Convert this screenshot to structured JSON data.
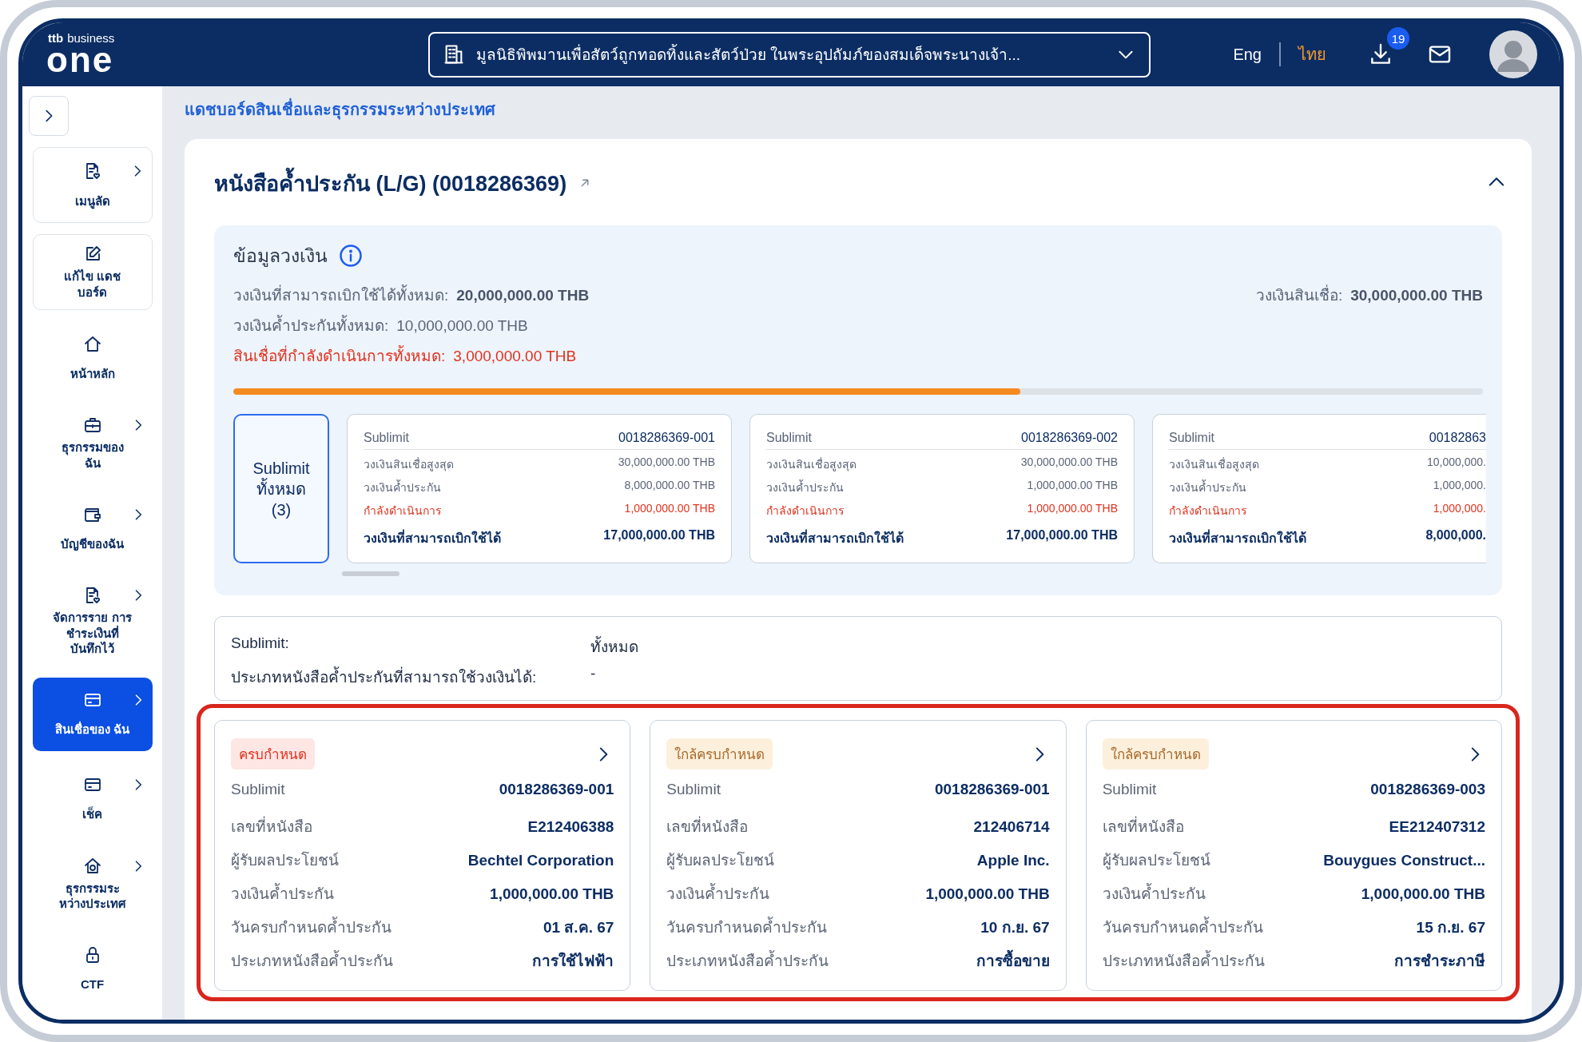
{
  "header": {
    "logo": {
      "brand": "ttb",
      "tagline": "business",
      "name": "one"
    },
    "organization": {
      "value": "มูลนิธิพิพมานเพื่อสัตว์ถูกทอดทิ้งและสัตว์ป่วย ในพระอุปถัมภ์ของสมเด็จพระนางเจ้า..."
    },
    "languages": [
      {
        "label": "Eng",
        "selected": false
      },
      {
        "label": "ไทย",
        "selected": true
      }
    ],
    "downloads_badge": "19"
  },
  "sidebar": {
    "items": [
      {
        "label": "เมนูลัด",
        "kind": "shortcut",
        "expandable": true,
        "selected": false
      },
      {
        "label": "แก้ไข แดชบอร์ด",
        "kind": "shortcut",
        "expandable": false,
        "selected": false
      },
      {
        "label": "หน้าหลัก",
        "kind": "nav",
        "expandable": false,
        "selected": false
      },
      {
        "label": "ธุรกรรมของ ฉัน",
        "kind": "nav",
        "expandable": true,
        "selected": false
      },
      {
        "label": "บัญชีของฉัน",
        "kind": "nav",
        "expandable": true,
        "selected": false
      },
      {
        "label": "จัดการราย การชำระเงินที่ บันทึกไว้",
        "kind": "nav",
        "expandable": true,
        "selected": false
      },
      {
        "label": "สินเชื่อของ ฉัน",
        "kind": "nav",
        "expandable": true,
        "selected": true
      },
      {
        "label": "เช็ค",
        "kind": "nav",
        "expandable": true,
        "selected": false
      },
      {
        "label": "ธุรกรรมระ หว่างประเทศ",
        "kind": "nav",
        "expandable": true,
        "selected": false
      },
      {
        "label": "CTF",
        "kind": "nav",
        "expandable": false,
        "selected": false
      }
    ]
  },
  "breadcrumb": "แดชบอร์ดสินเชื่อและธุรกรรมระหว่างประเทศ",
  "lg": {
    "title": "หนังสือค้ำประกัน (L/G) (0018286369)",
    "expanded": true,
    "limit_info": {
      "heading": "ข้อมูลวงเงิน",
      "lines": [
        {
          "label": "วงเงินที่สามารถเบิกใช้ได้ทั้งหมด:",
          "value": "20,000,000.00 THB",
          "kind": "available"
        },
        {
          "label": "วงเงินค้ำประกันทั้งหมด:",
          "value": "10,000,000.00 THB",
          "kind": "guarantee"
        },
        {
          "label": "สินเชื่อที่กำลังดำเนินการทั้งหมด:",
          "value": "3,000,000.00 THB",
          "kind": "pending"
        }
      ],
      "credit_limit": {
        "label": "วงเงินสินเชื่อ:",
        "value": "30,000,000.00 THB"
      },
      "level": 0.63,
      "sublimit_all": {
        "label": "Sublimit ทั้งหมด (3)",
        "selected": true
      },
      "sublimits": [
        {
          "id_label": "Sublimit",
          "id": "0018286369-001",
          "selected": false,
          "rows": [
            {
              "label": "วงเงินสินเชื่อสูงสุด",
              "value": "30,000,000.00 THB",
              "kind": "normal"
            },
            {
              "label": "วงเงินค้ำประกัน",
              "value": "8,000,000.00 THB",
              "kind": "normal"
            },
            {
              "label": "กำลังดำเนินการ",
              "value": "1,000,000.00 THB",
              "kind": "pending"
            },
            {
              "label": "วงเงินที่สามารถเบิกใช้ได้",
              "value": "17,000,000.00 THB",
              "kind": "total"
            }
          ]
        },
        {
          "id_label": "Sublimit",
          "id": "0018286369-002",
          "selected": false,
          "rows": [
            {
              "label": "วงเงินสินเชื่อสูงสุด",
              "value": "30,000,000.00 THB",
              "kind": "normal"
            },
            {
              "label": "วงเงินค้ำประกัน",
              "value": "1,000,000.00 THB",
              "kind": "normal"
            },
            {
              "label": "กำลังดำเนินการ",
              "value": "1,000,000.00 THB",
              "kind": "pending"
            },
            {
              "label": "วงเงินที่สามารถเบิกใช้ได้",
              "value": "17,000,000.00 THB",
              "kind": "total"
            }
          ]
        },
        {
          "id_label": "Sublimit",
          "id": "00182863",
          "selected": false,
          "rows": [
            {
              "label": "วงเงินสินเชื่อสูงสุด",
              "value": "10,000,000.",
              "kind": "normal"
            },
            {
              "label": "วงเงินค้ำประกัน",
              "value": "1,000,000.",
              "kind": "normal"
            },
            {
              "label": "กำลังดำเนินการ",
              "value": "1,000,000.",
              "kind": "pending"
            },
            {
              "label": "วงเงินที่สามารถเบิกใช้ได้",
              "value": "8,000,000.",
              "kind": "total"
            }
          ]
        }
      ]
    },
    "filter": {
      "rows": [
        {
          "label": "Sublimit:",
          "value": "ทั้งหมด"
        },
        {
          "label": "ประเภทหนังสือค้ำประกันที่สามารถใช้วงเงินได้:",
          "value": "-"
        }
      ]
    },
    "cards": [
      {
        "status": {
          "label": "ครบกำหนด",
          "kind": "overdue"
        },
        "rows": [
          {
            "label": "Sublimit",
            "value": "0018286369-001"
          },
          {
            "label": "เลขที่หนังสือ",
            "value": "E212406388"
          },
          {
            "label": "ผู้รับผลประโยชน์",
            "value": "Bechtel Corporation"
          },
          {
            "label": "วงเงินค้ำประกัน",
            "value": "1,000,000.00 THB"
          },
          {
            "label": "วันครบกำหนดค้ำประกัน",
            "value": "01 ส.ค. 67"
          },
          {
            "label": "ประเภทหนังสือค้ำประกัน",
            "value": "การใช้ไฟฟ้า"
          }
        ]
      },
      {
        "status": {
          "label": "ใกล้ครบกำหนด",
          "kind": "due_soon"
        },
        "rows": [
          {
            "label": "Sublimit",
            "value": "0018286369-001"
          },
          {
            "label": "เลขที่หนังสือ",
            "value": "212406714"
          },
          {
            "label": "ผู้รับผลประโยชน์",
            "value": "Apple Inc."
          },
          {
            "label": "วงเงินค้ำประกัน",
            "value": "1,000,000.00 THB"
          },
          {
            "label": "วันครบกำหนดค้ำประกัน",
            "value": "10 ก.ย. 67"
          },
          {
            "label": "ประเภทหนังสือค้ำประกัน",
            "value": "การซื้อขาย"
          }
        ]
      },
      {
        "status": {
          "label": "ใกล้ครบกำหนด",
          "kind": "due_soon"
        },
        "rows": [
          {
            "label": "Sublimit",
            "value": "0018286369-003"
          },
          {
            "label": "เลขที่หนังสือ",
            "value": "EE212407312"
          },
          {
            "label": "ผู้รับผลประโยชน์",
            "value": "Bouygues Construct..."
          },
          {
            "label": "วงเงินค้ำประกัน",
            "value": "1,000,000.00 THB"
          },
          {
            "label": "วันครบกำหนดค้ำประกัน",
            "value": "15 ก.ย. 67"
          },
          {
            "label": "ประเภทหนังสือค้ำประกัน",
            "value": "การชำระภาษี"
          }
        ]
      }
    ],
    "annotation": {
      "kind": "highlight"
    }
  }
}
